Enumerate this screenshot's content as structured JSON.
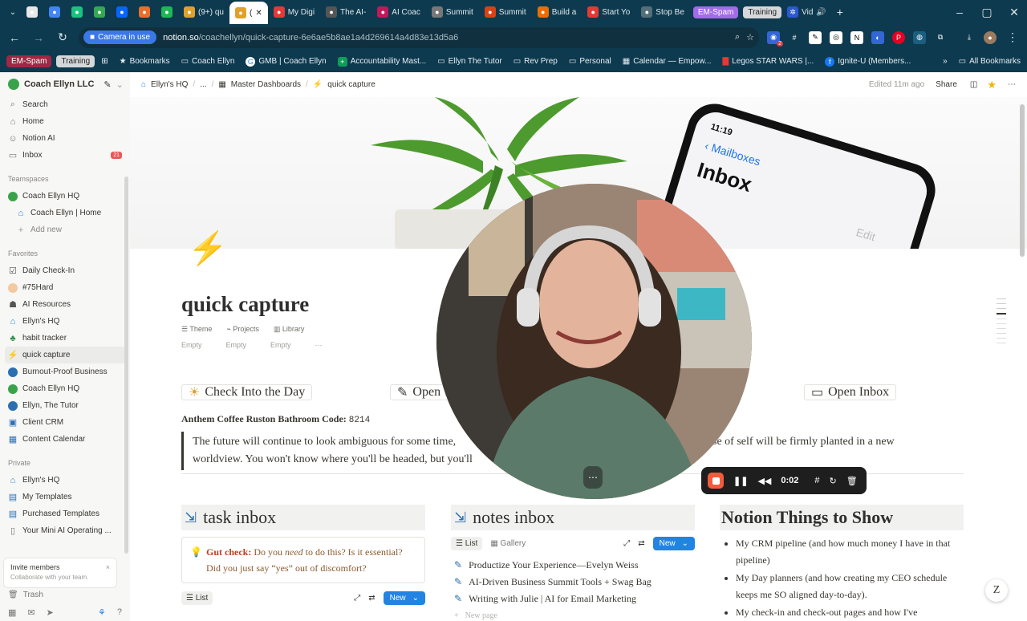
{
  "browser": {
    "tabs": [
      {
        "label": "",
        "icon": "record-icon",
        "color": "#e8e8e8"
      },
      {
        "label": "",
        "icon": "google-icon",
        "color": "#4285f4"
      },
      {
        "label": "",
        "icon": "chatgpt-icon",
        "color": "#19c37d"
      },
      {
        "label": "",
        "icon": "green-icon",
        "color": "#34a853"
      },
      {
        "label": "",
        "icon": "meta-icon",
        "color": "#0866ff"
      },
      {
        "label": "",
        "icon": "r-icon",
        "color": "#e8702a"
      },
      {
        "label": "",
        "icon": "phone-icon",
        "color": "#1db954"
      },
      {
        "label": "(9+) qu",
        "icon": "lightning-icon",
        "color": "#e0a12a"
      },
      {
        "label": "(",
        "icon": "lightning-icon",
        "color": "#e0a12a",
        "active": true
      },
      {
        "label": "My Digi",
        "icon": "sk-icon",
        "color": "#e53935"
      },
      {
        "label": "The AI-",
        "icon": "doc-icon",
        "color": "#555"
      },
      {
        "label": "AI Coac",
        "icon": "m-icon",
        "color": "#c2185b"
      },
      {
        "label": "Summit",
        "icon": "globe-icon",
        "color": "#777"
      },
      {
        "label": "Summit",
        "icon": "gear-icon",
        "color": "#d84315"
      },
      {
        "label": "Build a",
        "icon": "book-icon",
        "color": "#ef6c00"
      },
      {
        "label": "Start Yo",
        "icon": "bolt-icon",
        "color": "#e53935"
      },
      {
        "label": "Stop Be",
        "icon": "cap-icon",
        "color": "#546e7a"
      }
    ],
    "tab_pills": [
      "EM-Spam",
      "Training"
    ],
    "tab_tail": "Vid",
    "camera_chip": "Camera in use",
    "url_domain": "notion.so",
    "url_path": "/coachellyn/quick-capture-6e6ae5b8ae1a4d269614a4d83e13d5a6",
    "bookmarks": [
      "EM-Spam",
      "Training",
      "Bookmarks",
      "Coach Ellyn",
      "GMB | Coach Ellyn",
      "Accountability Mast...",
      "Ellyn The Tutor",
      "Rev Prep",
      "Personal",
      "Calendar — Empow...",
      "Legos STAR WARS |...",
      "Ignite-U (Members..."
    ],
    "all_bookmarks": "All Bookmarks",
    "ext_badge": "2"
  },
  "sidebar": {
    "workspace": "Coach Ellyn LLC",
    "top": [
      {
        "label": "Search",
        "icon": "search-icon"
      },
      {
        "label": "Home",
        "icon": "home-icon"
      },
      {
        "label": "Notion AI",
        "icon": "ai-face-icon"
      },
      {
        "label": "Inbox",
        "icon": "inbox-icon",
        "badge": "21"
      }
    ],
    "teamspaces_label": "Teamspaces",
    "teamspaces": [
      {
        "label": "Coach Ellyn HQ",
        "icon": "green-circle-icon"
      },
      {
        "label": "Coach Ellyn | Home",
        "icon": "house-icon"
      },
      {
        "label": "Add new",
        "icon": "plus-icon"
      }
    ],
    "favorites_label": "Favorites",
    "favorites": [
      {
        "label": "Daily Check-In",
        "icon": "checklist-icon"
      },
      {
        "label": "#75Hard",
        "icon": "hand-icon"
      },
      {
        "label": "AI Resources",
        "icon": "robot-icon"
      },
      {
        "label": "Ellyn's HQ",
        "icon": "house-icon"
      },
      {
        "label": "habit tracker",
        "icon": "leaf-icon"
      },
      {
        "label": "quick capture",
        "icon": "lightning-icon",
        "active": true
      },
      {
        "label": "Burnout-Proof Business",
        "icon": "globe-icon"
      },
      {
        "label": "Coach Ellyn HQ",
        "icon": "green-circle-icon"
      },
      {
        "label": "Ellyn, The Tutor",
        "icon": "swirl-icon"
      },
      {
        "label": "Client CRM",
        "icon": "crm-icon"
      },
      {
        "label": "Content Calendar",
        "icon": "calendar-icon"
      }
    ],
    "private_label": "Private",
    "private": [
      {
        "label": "Ellyn's HQ",
        "icon": "house-icon"
      },
      {
        "label": "My Templates",
        "icon": "template-icon"
      },
      {
        "label": "Purchased Templates",
        "icon": "template-icon"
      },
      {
        "label": "Your Mini AI Operating ...",
        "icon": "page-icon"
      }
    ],
    "invite_title": "Invite members",
    "invite_sub": "Collaborate with your team.",
    "trash": "Trash"
  },
  "topbar": {
    "crumbs": [
      "Ellyn's HQ",
      "...",
      "Master Dashboards",
      "quick capture"
    ],
    "edited": "Edited 11m ago",
    "share": "Share"
  },
  "cover": {
    "phone_time": "11:19",
    "phone_back": "Mailboxes",
    "phone_title": "Inbox",
    "phone_edit": "Edit"
  },
  "page": {
    "title": "quick capture",
    "props": [
      "Theme",
      "Projects",
      "Library"
    ],
    "prop_values": [
      "Empty",
      "Empty",
      "Empty"
    ],
    "prop_more": "···",
    "buttons": [
      "Check Into the Day",
      "Open Today",
      "Open Inbox"
    ],
    "code_label": "Anthem Coffee Ruston Bathroom Code:",
    "code_value": "8214",
    "quote_l1": "The future will continue to look ambiguous for some time,",
    "quote_l1b": "ur sense of self will be firmly planted in a new",
    "quote_l2": "worldview. You won't know where you'll be headed, but you'll"
  },
  "task_inbox": {
    "title": "task inbox",
    "callout_bold": "Gut check:",
    "callout_a": " Do you ",
    "callout_em": "need",
    "callout_b": " to do this? Is it essential?",
    "callout_c": "Did you just say “yes” out of discomfort?",
    "view": "List",
    "new": "New"
  },
  "notes_inbox": {
    "title": "notes inbox",
    "views": [
      "List",
      "Gallery"
    ],
    "new": "New",
    "items": [
      "Productize Your Experience—Evelyn Weiss",
      "AI-Driven Business Summit Tools + Swag Bag",
      "Writing with Julie | AI for Email Marketing"
    ],
    "new_page": "New page"
  },
  "notion_things": {
    "title": "Notion Things to Show",
    "bullets": [
      "My CRM pipeline (and how much money I have in that pipeline)",
      "My Day planners (and how creating my CEO schedule keeps me SO aligned day-to-day).",
      "My check-in and check-out pages and how I've"
    ]
  },
  "recorder": {
    "time": "0:02"
  }
}
